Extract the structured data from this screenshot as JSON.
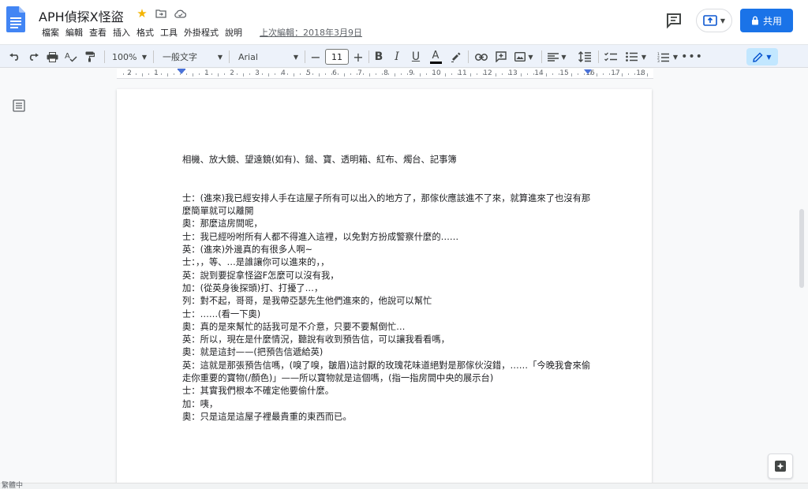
{
  "app": {
    "doc_title": "APH偵探X怪盜",
    "last_edit": "上次編輯：2018年3月9日",
    "share_label": "共用",
    "accent_color": "#1a73e8"
  },
  "menu": [
    "檔案",
    "編輯",
    "查看",
    "插入",
    "格式",
    "工具",
    "外掛程式",
    "說明"
  ],
  "toolbar": {
    "zoom": "100%",
    "style": "一般文字",
    "font": "Arial",
    "font_size": "11"
  },
  "ruler": {
    "labels": [
      "2",
      "1",
      "1",
      "2",
      "3",
      "4",
      "5",
      "6",
      "7",
      "8",
      "9",
      "10",
      "11",
      "12",
      "13",
      "14",
      "15",
      "16",
      "17",
      "18"
    ]
  },
  "document": {
    "lines": [
      "相機、放大鏡、望遠鏡(如有)、鎚、寶、透明箱、紅布、燭台、記事簿",
      "",
      "",
      "士：(進來)我已經安排人手在這屋子所有可以出入的地方了，那傢伙應該進不了來，就算進來了也沒有那麼簡單就可以離開",
      "奧：那麼這房間呢，",
      "士：我已經吩咐所有人都不得進入這裡，以免對方扮成警察什麼的……",
      "英：(進來)外邊真的有很多人啊~",
      "士：，，等、…是誰讓你可以進來的，，",
      "英：說到要捉拿怪盜F怎麼可以沒有我，",
      "加：(從英身後探頭)打、打擾了…，",
      "列：對不起，哥哥，是我帶亞瑟先生他們進來的，他說可以幫忙",
      "士：……(看一下奧)",
      "奧：真的是來幫忙的話我可是不介意，只要不要幫倒忙…",
      "英：所以，現在是什麼情況，聽說有收到預告信，可以讓我看看嗎，",
      "奧：就是這封——(把預告信遞給英)",
      "英：這就是那張預告信嗎，(嗅了嗅，皺眉)這討厭的玫瑰花味道絕對是那傢伙沒錯，……「今晚我會來偷走你重要的寶物(/顏色)」——所以寶物就是這個嗎，(指一指房間中央的展示台)",
      "士：其實我們根本不確定他要偷什麼。",
      "加：咦，",
      "奧：只是這是這屋子裡最貴重的東西而已。"
    ]
  },
  "bottom_label": "繁體中"
}
